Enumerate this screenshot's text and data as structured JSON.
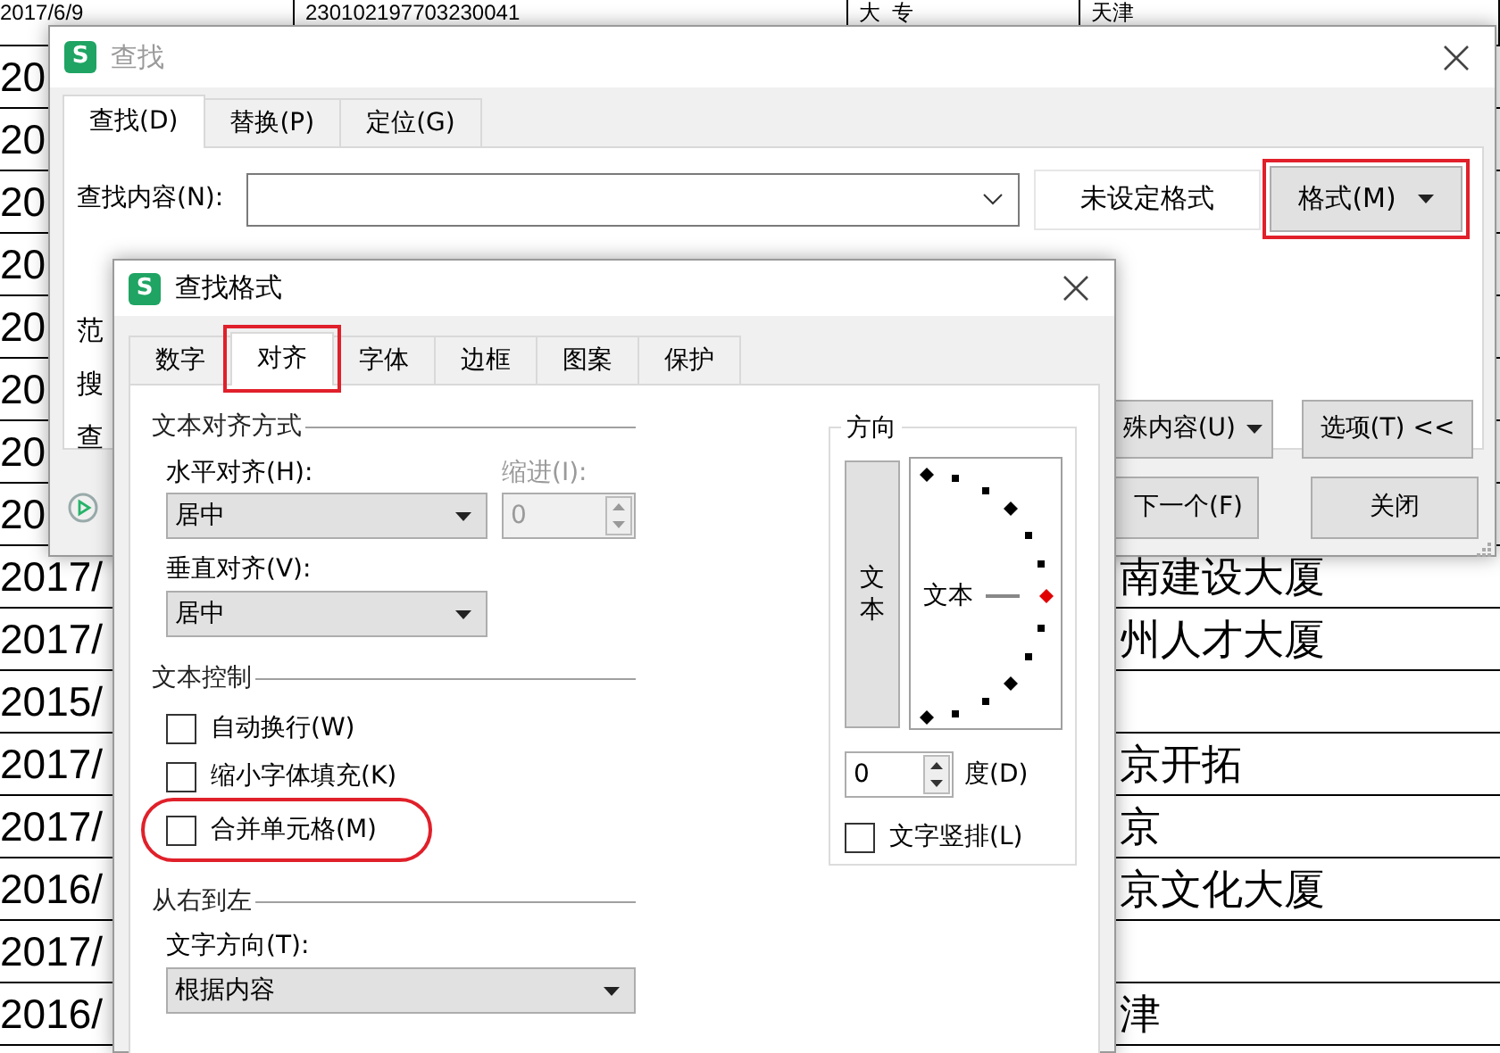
{
  "spreadsheet": {
    "top_row": [
      "2017/6/9",
      "230102197703230041",
      "大  专",
      "天津"
    ],
    "rows": [
      {
        "date": "20"
      },
      {
        "date": "20"
      },
      {
        "date": "20"
      },
      {
        "date": "20"
      },
      {
        "date": "20"
      },
      {
        "date": "20"
      },
      {
        "date": "20"
      },
      {
        "date": "20"
      },
      {
        "date": "2017/",
        "place": "南建设大厦"
      },
      {
        "date": "2017/",
        "place": "州人才大厦"
      },
      {
        "date": "2015/"
      },
      {
        "date": "2017/",
        "place": "京开拓"
      },
      {
        "date": "2017/",
        "place": "京"
      },
      {
        "date": "2016/",
        "place": "京文化大厦"
      },
      {
        "date": "2017/"
      },
      {
        "date": "2016/",
        "place": "津"
      }
    ]
  },
  "find_dialog": {
    "icon_letter": "S",
    "title": "查找",
    "active": false,
    "tabs": [
      {
        "label": "查找(D)",
        "selected": true
      },
      {
        "label": "替换(P)",
        "selected": false
      },
      {
        "label": "定位(G)",
        "selected": false
      }
    ],
    "find_label": "查找内容(N):",
    "format_status": "未设定格式",
    "format_button": {
      "label": "格式(M)",
      "highlighted": true
    },
    "covered_labels": [
      "范",
      "搜",
      "查"
    ],
    "special_button": "殊内容(U)",
    "options_button": "选项(T) <<",
    "find_next_button": "下一个(F)",
    "close_button": "关闭"
  },
  "format_dialog": {
    "icon_letter": "S",
    "title": "查找格式",
    "active": true,
    "tabs": [
      {
        "label": "数字",
        "selected": false,
        "highlighted": false
      },
      {
        "label": "对齐",
        "selected": true,
        "highlighted": true
      },
      {
        "label": "字体",
        "selected": false,
        "highlighted": false
      },
      {
        "label": "边框",
        "selected": false,
        "highlighted": false
      },
      {
        "label": "图案",
        "selected": false,
        "highlighted": false
      },
      {
        "label": "保护",
        "selected": false,
        "highlighted": false
      }
    ],
    "alignment": {
      "title": "文本对齐方式",
      "horizontal_label": "水平对齐(H):",
      "horizontal_value": "居中",
      "indent_label": "缩进(I):",
      "indent_value": "0",
      "indent_disabled": true,
      "vertical_label": "垂直对齐(V):",
      "vertical_value": "居中"
    },
    "text_control": {
      "title": "文本控制",
      "options": [
        {
          "label": "自动换行(W)",
          "checked": false
        },
        {
          "label": "缩小字体填充(K)",
          "checked": false
        },
        {
          "label": "合并单元格(M)",
          "checked": false,
          "highlighted": true
        }
      ]
    },
    "right_to_left": {
      "title": "从右到左",
      "direction_label": "文字方向(T):",
      "direction_value": "根据内容"
    },
    "orientation": {
      "title": "方向",
      "vertical_text_button": "文本",
      "dial_label": "文本",
      "degrees_value": "0",
      "degrees_label": "度(D)",
      "vertical_text": {
        "label": "文字竖排(L)",
        "checked": false
      }
    }
  }
}
